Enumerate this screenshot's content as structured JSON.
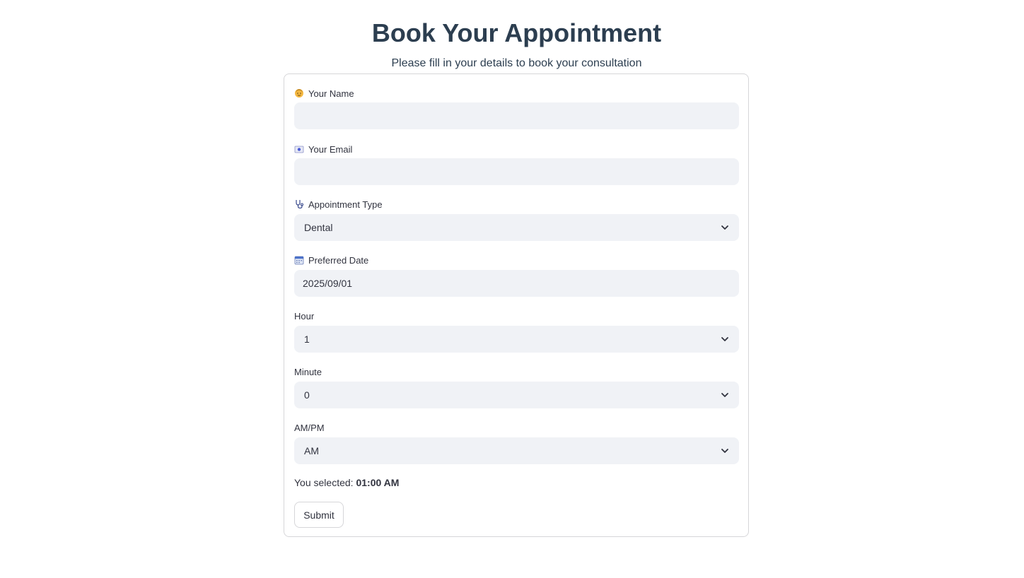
{
  "header": {
    "title": "Book Your Appointment",
    "subtitle": "Please fill in your details to book your consultation"
  },
  "form": {
    "name": {
      "label": "Your Name",
      "icon": "person-icon",
      "value": ""
    },
    "email": {
      "label": "Your Email",
      "icon": "email-card-icon",
      "value": ""
    },
    "appointment_type": {
      "label": "Appointment Type",
      "icon": "stethoscope-icon",
      "value": "Dental"
    },
    "preferred_date": {
      "label": "Preferred Date",
      "icon": "calendar-icon",
      "value": "2025/09/01"
    },
    "hour": {
      "label": "Hour",
      "value": "1"
    },
    "minute": {
      "label": "Minute",
      "value": "0"
    },
    "ampm": {
      "label": "AM/PM",
      "value": "AM"
    },
    "selected": {
      "prefix": "You selected:",
      "value": "01:00 AM"
    },
    "submit_label": "Submit"
  },
  "colors": {
    "title": "#2c3e50",
    "text": "#31333f",
    "field_bg": "#f0f2f6",
    "border": "#d6d6d9"
  }
}
